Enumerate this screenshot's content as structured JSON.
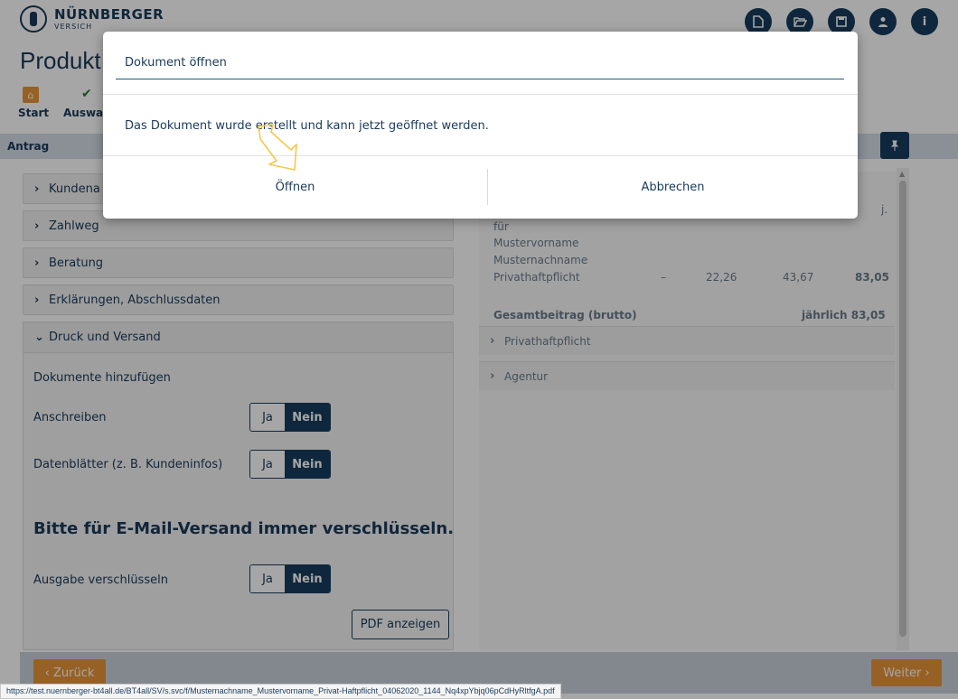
{
  "header": {
    "logo_name": "NÜRNBERGER",
    "logo_sub": "VERSICH",
    "icons": [
      "document-icon",
      "folder-open-icon",
      "save-icon",
      "user-icon",
      "info-icon"
    ]
  },
  "page": {
    "title": "Produkt"
  },
  "steps": {
    "start_label": "Start",
    "auswahl_label": "Auswahl"
  },
  "section": {
    "label": "Antrag"
  },
  "accordion": {
    "items": [
      {
        "label": "Kundena"
      },
      {
        "label": "Zahlweg"
      },
      {
        "label": "Beratung"
      },
      {
        "label": "Erklärungen, Abschlussdaten"
      }
    ],
    "open_item": {
      "label": "Druck und Versand",
      "add_docs_label": "Dokumente hinzufügen",
      "anschreiben_label": "Anschreiben",
      "datenblaetter_label": "Datenblätter (z. B. Kundeninfos)",
      "encrypt_heading": "Bitte für E-Mail-Versand immer verschlüsseln.",
      "ausgabe_label": "Ausgabe verschlüsseln",
      "toggle_yes": "Ja",
      "toggle_no": "Nein",
      "pdf_button": "PDF anzeigen"
    }
  },
  "right_panel": {
    "j_label": "j.",
    "fuer": "für",
    "first_name": "Mustervorname",
    "last_name": "Musternachname",
    "product": "Privathaftpflicht",
    "dash": "–",
    "value1": "22,26",
    "value2": "43,67",
    "value3": "83,05",
    "total_label": "Gesamtbeitrag (brutto)",
    "total_value": "jährlich 83,05",
    "acc_privathaftpflicht": "Privathaftpflicht",
    "acc_agentur": "Agentur"
  },
  "footer": {
    "back": "Zurück",
    "next": "Weiter",
    "status_url": "https://test.nuernberger-bt4all.de/BT4all/SV/s.svc/f/Musternachname_Mustervorname_Privat-Haftpflicht_04062020_1144_Nq4xpYbjq06pCdHyRltfgA.pdf"
  },
  "modal": {
    "title": "Dokument öffnen",
    "message": "Das Dokument wurde erstellt und kann jetzt geöffnet werden.",
    "open_button": "Öffnen",
    "cancel_button": "Abbrechen"
  },
  "colors": {
    "primary": "#183c5e",
    "accent": "#e8953a",
    "cursor": "#f2c94c"
  }
}
